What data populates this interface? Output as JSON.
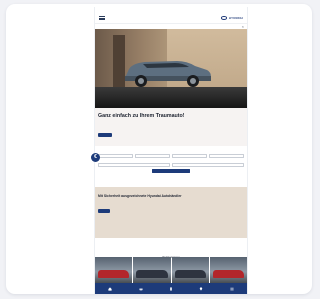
{
  "page": {
    "background_color": "#f1f2f6",
    "accent_color": "#1d3b7a"
  },
  "topbar": {
    "links": [
      "",
      "",
      "",
      ""
    ]
  },
  "header": {
    "dealer_name": "",
    "brand_name": "HYUNDAI"
  },
  "hero": {
    "image_alt": "car-hero-image"
  },
  "offer": {
    "title": "Ganz einfach zu Ihrem Traumauto!",
    "subtitle": "",
    "button_label": ""
  },
  "form": {
    "badge": "€",
    "fields_row1": [
      {
        "label": "",
        "value": ""
      },
      {
        "label": "",
        "value": ""
      },
      {
        "label": "",
        "value": ""
      },
      {
        "label": "",
        "value": ""
      }
    ],
    "fields_row2": [
      {
        "label": "",
        "value": ""
      },
      {
        "label": "",
        "value": ""
      }
    ],
    "submit_label": ""
  },
  "service": {
    "title": "Mit Sicherheit ausgezeichnete Hyundai Autohändler",
    "button_label": ""
  },
  "vehicles": {
    "title": "Ihr Neuwagen"
  },
  "bottom_nav": {
    "icons": [
      "home-icon",
      "car-icon",
      "phone-icon",
      "map-icon",
      "menu-icon"
    ]
  }
}
